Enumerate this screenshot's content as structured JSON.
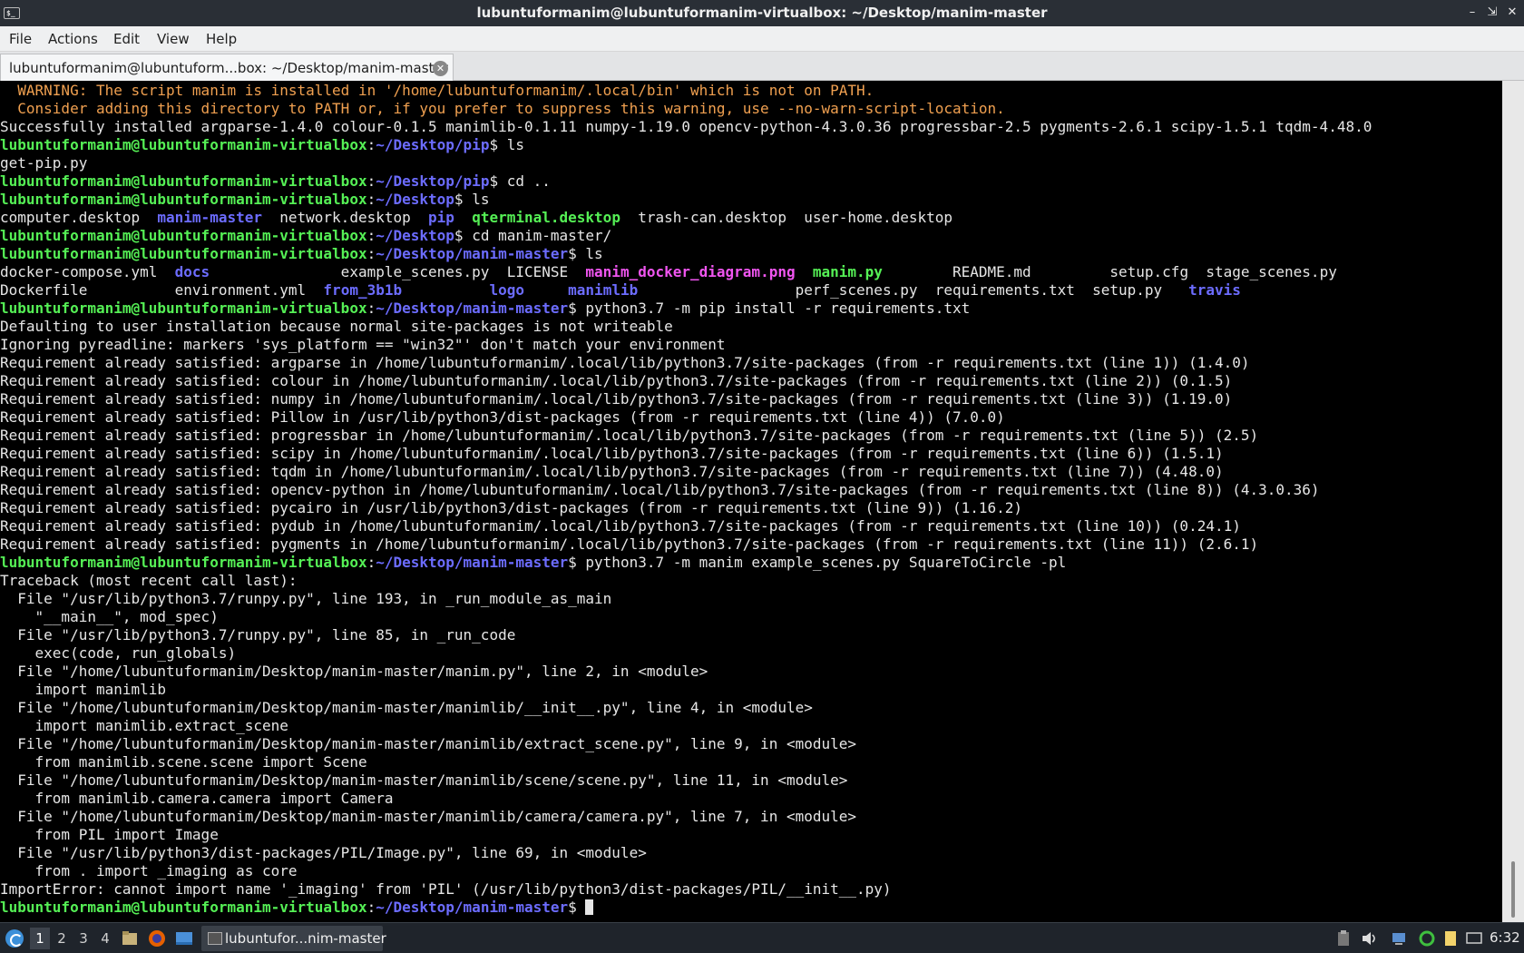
{
  "window": {
    "title": "lubuntuformanim@lubuntuformanim-virtualbox: ~/Desktop/manim-master",
    "app_icon": "$_"
  },
  "menu": [
    "File",
    "Actions",
    "Edit",
    "View",
    "Help"
  ],
  "tab": {
    "label": "lubuntuformanim@lubuntuform...box: ~/Desktop/manim-master"
  },
  "terminal": {
    "prompt_user": "lubuntuformanim@lubuntuformanim-virtualbox",
    "lines": [
      [
        {
          "t": "  WARNING: The script manim is installed in '/home/lubuntuformanim/.local/bin' which is not on PATH.",
          "c": "warn"
        }
      ],
      [
        {
          "t": "  Consider adding this directory to PATH or, if you prefer to suppress this warning, use --no-warn-script-location.",
          "c": "warn"
        }
      ],
      [
        {
          "t": "Successfully installed argparse-1.4.0 colour-0.1.5 manimlib-0.1.11 numpy-1.19.0 opencv-python-4.3.0.36 progressbar-2.5 pygments-2.6.1 scipy-1.5.1 tqdm-4.48.0",
          "c": ""
        }
      ],
      [
        {
          "t": "lubuntuformanim@lubuntuformanim-virtualbox",
          "c": "user"
        },
        {
          "t": ":",
          "c": ""
        },
        {
          "t": "~/Desktop/pip",
          "c": "path"
        },
        {
          "t": "$ ls",
          "c": ""
        }
      ],
      [
        {
          "t": "get-pip.py",
          "c": ""
        }
      ],
      [
        {
          "t": "lubuntuformanim@lubuntuformanim-virtualbox",
          "c": "user"
        },
        {
          "t": ":",
          "c": ""
        },
        {
          "t": "~/Desktop/pip",
          "c": "path"
        },
        {
          "t": "$ cd ..",
          "c": ""
        }
      ],
      [
        {
          "t": "lubuntuformanim@lubuntuformanim-virtualbox",
          "c": "user"
        },
        {
          "t": ":",
          "c": ""
        },
        {
          "t": "~/Desktop",
          "c": "path"
        },
        {
          "t": "$ ls",
          "c": ""
        }
      ],
      [
        {
          "t": "computer.desktop  ",
          "c": ""
        },
        {
          "t": "manim-master",
          "c": "dir"
        },
        {
          "t": "  network.desktop  ",
          "c": ""
        },
        {
          "t": "pip",
          "c": "dir"
        },
        {
          "t": "  ",
          "c": ""
        },
        {
          "t": "qterminal.desktop",
          "c": "exe"
        },
        {
          "t": "  trash-can.desktop  user-home.desktop",
          "c": ""
        }
      ],
      [
        {
          "t": "lubuntuformanim@lubuntuformanim-virtualbox",
          "c": "user"
        },
        {
          "t": ":",
          "c": ""
        },
        {
          "t": "~/Desktop",
          "c": "path"
        },
        {
          "t": "$ cd manim-master/",
          "c": ""
        }
      ],
      [
        {
          "t": "lubuntuformanim@lubuntuformanim-virtualbox",
          "c": "user"
        },
        {
          "t": ":",
          "c": ""
        },
        {
          "t": "~/Desktop/manim-master",
          "c": "path"
        },
        {
          "t": "$ ls",
          "c": ""
        }
      ],
      [
        {
          "t": "docker-compose.yml  ",
          "c": ""
        },
        {
          "t": "docs",
          "c": "dir"
        },
        {
          "t": "               example_scenes.py  LICENSE  ",
          "c": ""
        },
        {
          "t": "manim_docker_diagram.png",
          "c": "img"
        },
        {
          "t": "  ",
          "c": ""
        },
        {
          "t": "manim.py",
          "c": "exe"
        },
        {
          "t": "        README.md         setup.cfg  stage_scenes.py",
          "c": ""
        }
      ],
      [
        {
          "t": "Dockerfile          environment.yml  ",
          "c": ""
        },
        {
          "t": "from_3b1b",
          "c": "dir"
        },
        {
          "t": "          ",
          "c": ""
        },
        {
          "t": "logo",
          "c": "dir"
        },
        {
          "t": "     ",
          "c": ""
        },
        {
          "t": "manimlib",
          "c": "dir"
        },
        {
          "t": "                  perf_scenes.py  requirements.txt  setup.py   ",
          "c": ""
        },
        {
          "t": "travis",
          "c": "dir"
        }
      ],
      [
        {
          "t": "lubuntuformanim@lubuntuformanim-virtualbox",
          "c": "user"
        },
        {
          "t": ":",
          "c": ""
        },
        {
          "t": "~/Desktop/manim-master",
          "c": "path"
        },
        {
          "t": "$ python3.7 -m pip install -r requirements.txt",
          "c": ""
        }
      ],
      [
        {
          "t": "Defaulting to user installation because normal site-packages is not writeable",
          "c": ""
        }
      ],
      [
        {
          "t": "Ignoring pyreadline: markers 'sys_platform == \"win32\"' don't match your environment",
          "c": ""
        }
      ],
      [
        {
          "t": "Requirement already satisfied: argparse in /home/lubuntuformanim/.local/lib/python3.7/site-packages (from -r requirements.txt (line 1)) (1.4.0)",
          "c": ""
        }
      ],
      [
        {
          "t": "Requirement already satisfied: colour in /home/lubuntuformanim/.local/lib/python3.7/site-packages (from -r requirements.txt (line 2)) (0.1.5)",
          "c": ""
        }
      ],
      [
        {
          "t": "Requirement already satisfied: numpy in /home/lubuntuformanim/.local/lib/python3.7/site-packages (from -r requirements.txt (line 3)) (1.19.0)",
          "c": ""
        }
      ],
      [
        {
          "t": "Requirement already satisfied: Pillow in /usr/lib/python3/dist-packages (from -r requirements.txt (line 4)) (7.0.0)",
          "c": ""
        }
      ],
      [
        {
          "t": "Requirement already satisfied: progressbar in /home/lubuntuformanim/.local/lib/python3.7/site-packages (from -r requirements.txt (line 5)) (2.5)",
          "c": ""
        }
      ],
      [
        {
          "t": "Requirement already satisfied: scipy in /home/lubuntuformanim/.local/lib/python3.7/site-packages (from -r requirements.txt (line 6)) (1.5.1)",
          "c": ""
        }
      ],
      [
        {
          "t": "Requirement already satisfied: tqdm in /home/lubuntuformanim/.local/lib/python3.7/site-packages (from -r requirements.txt (line 7)) (4.48.0)",
          "c": ""
        }
      ],
      [
        {
          "t": "Requirement already satisfied: opencv-python in /home/lubuntuformanim/.local/lib/python3.7/site-packages (from -r requirements.txt (line 8)) (4.3.0.36)",
          "c": ""
        }
      ],
      [
        {
          "t": "Requirement already satisfied: pycairo in /usr/lib/python3/dist-packages (from -r requirements.txt (line 9)) (1.16.2)",
          "c": ""
        }
      ],
      [
        {
          "t": "Requirement already satisfied: pydub in /home/lubuntuformanim/.local/lib/python3.7/site-packages (from -r requirements.txt (line 10)) (0.24.1)",
          "c": ""
        }
      ],
      [
        {
          "t": "Requirement already satisfied: pygments in /home/lubuntuformanim/.local/lib/python3.7/site-packages (from -r requirements.txt (line 11)) (2.6.1)",
          "c": ""
        }
      ],
      [
        {
          "t": "lubuntuformanim@lubuntuformanim-virtualbox",
          "c": "user"
        },
        {
          "t": ":",
          "c": ""
        },
        {
          "t": "~/Desktop/manim-master",
          "c": "path"
        },
        {
          "t": "$ python3.7 -m manim example_scenes.py SquareToCircle -pl",
          "c": ""
        }
      ],
      [
        {
          "t": "Traceback (most recent call last):",
          "c": ""
        }
      ],
      [
        {
          "t": "  File \"/usr/lib/python3.7/runpy.py\", line 193, in _run_module_as_main",
          "c": ""
        }
      ],
      [
        {
          "t": "    \"__main__\", mod_spec)",
          "c": ""
        }
      ],
      [
        {
          "t": "  File \"/usr/lib/python3.7/runpy.py\", line 85, in _run_code",
          "c": ""
        }
      ],
      [
        {
          "t": "    exec(code, run_globals)",
          "c": ""
        }
      ],
      [
        {
          "t": "  File \"/home/lubuntuformanim/Desktop/manim-master/manim.py\", line 2, in <module>",
          "c": ""
        }
      ],
      [
        {
          "t": "    import manimlib",
          "c": ""
        }
      ],
      [
        {
          "t": "  File \"/home/lubuntuformanim/Desktop/manim-master/manimlib/__init__.py\", line 4, in <module>",
          "c": ""
        }
      ],
      [
        {
          "t": "    import manimlib.extract_scene",
          "c": ""
        }
      ],
      [
        {
          "t": "  File \"/home/lubuntuformanim/Desktop/manim-master/manimlib/extract_scene.py\", line 9, in <module>",
          "c": ""
        }
      ],
      [
        {
          "t": "    from manimlib.scene.scene import Scene",
          "c": ""
        }
      ],
      [
        {
          "t": "  File \"/home/lubuntuformanim/Desktop/manim-master/manimlib/scene/scene.py\", line 11, in <module>",
          "c": ""
        }
      ],
      [
        {
          "t": "    from manimlib.camera.camera import Camera",
          "c": ""
        }
      ],
      [
        {
          "t": "  File \"/home/lubuntuformanim/Desktop/manim-master/manimlib/camera/camera.py\", line 7, in <module>",
          "c": ""
        }
      ],
      [
        {
          "t": "    from PIL import Image",
          "c": ""
        }
      ],
      [
        {
          "t": "  File \"/usr/lib/python3/dist-packages/PIL/Image.py\", line 69, in <module>",
          "c": ""
        }
      ],
      [
        {
          "t": "    from . import _imaging as core",
          "c": ""
        }
      ],
      [
        {
          "t": "ImportError: cannot import name '_imaging' from 'PIL' (/usr/lib/python3/dist-packages/PIL/__init__.py)",
          "c": ""
        }
      ],
      [
        {
          "t": "lubuntuformanim@lubuntuformanim-virtualbox",
          "c": "user"
        },
        {
          "t": ":",
          "c": ""
        },
        {
          "t": "~/Desktop/manim-master",
          "c": "path"
        },
        {
          "t": "$ ",
          "c": ""
        },
        {
          "t": "",
          "c": "cursor"
        }
      ]
    ]
  },
  "taskbar": {
    "workspaces": [
      "1",
      "2",
      "3",
      "4"
    ],
    "active_workspace": 0,
    "task_label": "lubuntufor...nim-master",
    "clock": "6:32"
  },
  "colors": {
    "user": "#55f055",
    "path": "#6c6cff",
    "warning": "#f0a050",
    "image_file": "#f055f0",
    "text": "#e6e6e6"
  }
}
